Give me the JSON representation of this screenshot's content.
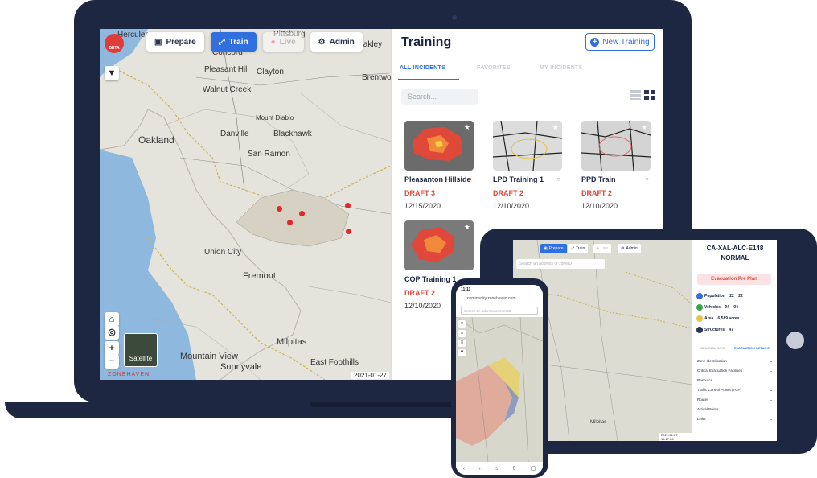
{
  "laptop": {
    "map": {
      "toolbar": {
        "prepare": "Prepare",
        "train": "Train",
        "live": "Live",
        "admin": "Admin"
      },
      "beta": "BETA",
      "satellite": "Satellite",
      "logo": "ZONEHAVEN",
      "date": "2021-01-27",
      "places": [
        "Hercules",
        "Pittsburg",
        "Concord",
        "Oakley",
        "Pleasant Hill",
        "Clayton",
        "Brentwood",
        "Walnut Creek",
        "Mount Diablo",
        "Danville",
        "Blackhawk",
        "Oakland",
        "San Ramon",
        "Union City",
        "Fremont",
        "Milpitas",
        "Mountain View",
        "Sunnyvale",
        "East Foothills"
      ],
      "controls": {
        "home": "⌂",
        "locate": "◎",
        "zoom_in": "+",
        "zoom_out": "−",
        "filter": "▼"
      }
    },
    "panel": {
      "title": "Training",
      "new_button": "New Training",
      "tabs": [
        "ALL INCIDENTS",
        "FAVORITES",
        "MY INCIDENTS"
      ],
      "search_placeholder": "Search...",
      "cards": [
        {
          "name": "Pleasanton Hillside",
          "status": "DRAFT 3",
          "date": "12/15/2020"
        },
        {
          "name": "LPD Training 1",
          "status": "DRAFT 2",
          "date": "12/10/2020"
        },
        {
          "name": "PPD Train",
          "status": "DRAFT 2",
          "date": "12/10/2020"
        },
        {
          "name": "COP Training 1",
          "status": "DRAFT 2",
          "date": "12/10/2020"
        }
      ]
    }
  },
  "tablet": {
    "toolbar": {
      "prepare": "Prepare",
      "train": "Train",
      "live": "Live",
      "admin": "Admin"
    },
    "search_placeholder": "Search an address or zoneID",
    "zone_id": "CA-XAL-ALC-E148",
    "zone_status": "NORMAL",
    "evac_button": "Evacuation Pre Plan",
    "stats": {
      "population_label": "Population",
      "population_a": "22",
      "population_b": "22",
      "vehicles_label": "Vehicles",
      "vehicles_a": "94",
      "vehicles_b": "94",
      "area_label": "Area",
      "area_value": "6,589 acres",
      "structures_label": "Structures",
      "structures_value": "47"
    },
    "tabs": [
      "GENERAL INFO",
      "EVACUATION DETAILS"
    ],
    "details": [
      "Zone Identification",
      "Critical Evacuation Facilities",
      "Resource",
      "Traffic Control Points (TCP)",
      "Routes",
      "Arrival Points",
      "Links"
    ],
    "date": "2021-01-27 15:17:26",
    "map_place": "Milpitas"
  },
  "phone": {
    "time": "11:11",
    "url": "community.zonehaven.com",
    "search_placeholder": "Search an address or zoneID"
  },
  "colors": {
    "navy": "#1e2742",
    "accent": "#2f6fe0",
    "danger": "#e0493a"
  }
}
